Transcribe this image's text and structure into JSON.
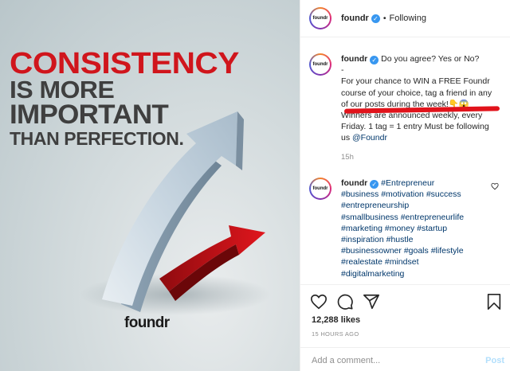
{
  "image": {
    "headline": [
      "CONSISTENCY",
      "IS MORE",
      "IMPORTANT",
      "THAN PERFECTION."
    ],
    "brand": "foundr",
    "colors": {
      "red": "#d0151c",
      "grey": "#3f3f3f"
    }
  },
  "header": {
    "avatar_text": "foundr",
    "username": "foundr",
    "verified_icon": "verified-badge-icon",
    "separator": "•",
    "follow_status": "Following"
  },
  "caption": {
    "avatar_text": "foundr",
    "username": "foundr",
    "first_line": "Do you agree? Yes or No?",
    "dash": "-",
    "body": "For your chance to WIN a FREE Foundr course of your choice, tag a friend in any of our posts during the week!👇😱 Winners are announced weekly, every Friday. 1 tag = 1 entry Must be following us",
    "mention": "@Foundr",
    "time": "15h"
  },
  "hashtag_comment": {
    "avatar_text": "foundr",
    "username": "foundr",
    "tags": [
      "#Entrepreneur",
      "#business",
      "#motivation",
      "#success",
      "#entrepreneurship",
      "#smallbusiness",
      "#entrepreneurlife",
      "#marketing",
      "#money",
      "#startup",
      "#inspiration",
      "#hustle",
      "#businessowner",
      "#goals",
      "#lifestyle",
      "#realestate",
      "#mindset",
      "#digitalmarketing"
    ]
  },
  "actions": {
    "icons": [
      "heart-icon",
      "comment-icon",
      "share-icon",
      "bookmark-icon"
    ],
    "likes": "12,288 likes",
    "timestamp": "15 HOURS AGO"
  },
  "add_comment": {
    "placeholder": "Add a comment...",
    "post_label": "Post"
  }
}
